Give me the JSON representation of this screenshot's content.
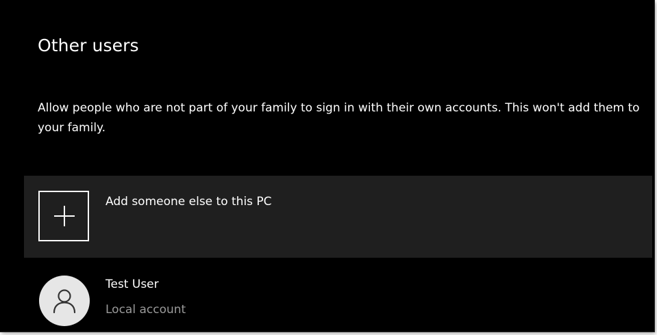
{
  "section": {
    "title": "Other users",
    "description": "Allow people who are not part of your family to sign in with their own accounts. This won't add them to your family."
  },
  "add_user": {
    "label": "Add someone else to this PC",
    "icon": "plus-icon"
  },
  "users": [
    {
      "name": "Test User",
      "type": "Local account",
      "icon": "person-icon"
    }
  ],
  "colors": {
    "background": "#000000",
    "row_background": "#1f1f1f",
    "text_primary": "#ffffff",
    "text_secondary": "#9a9a9a",
    "avatar_background": "#e6e6e6"
  }
}
